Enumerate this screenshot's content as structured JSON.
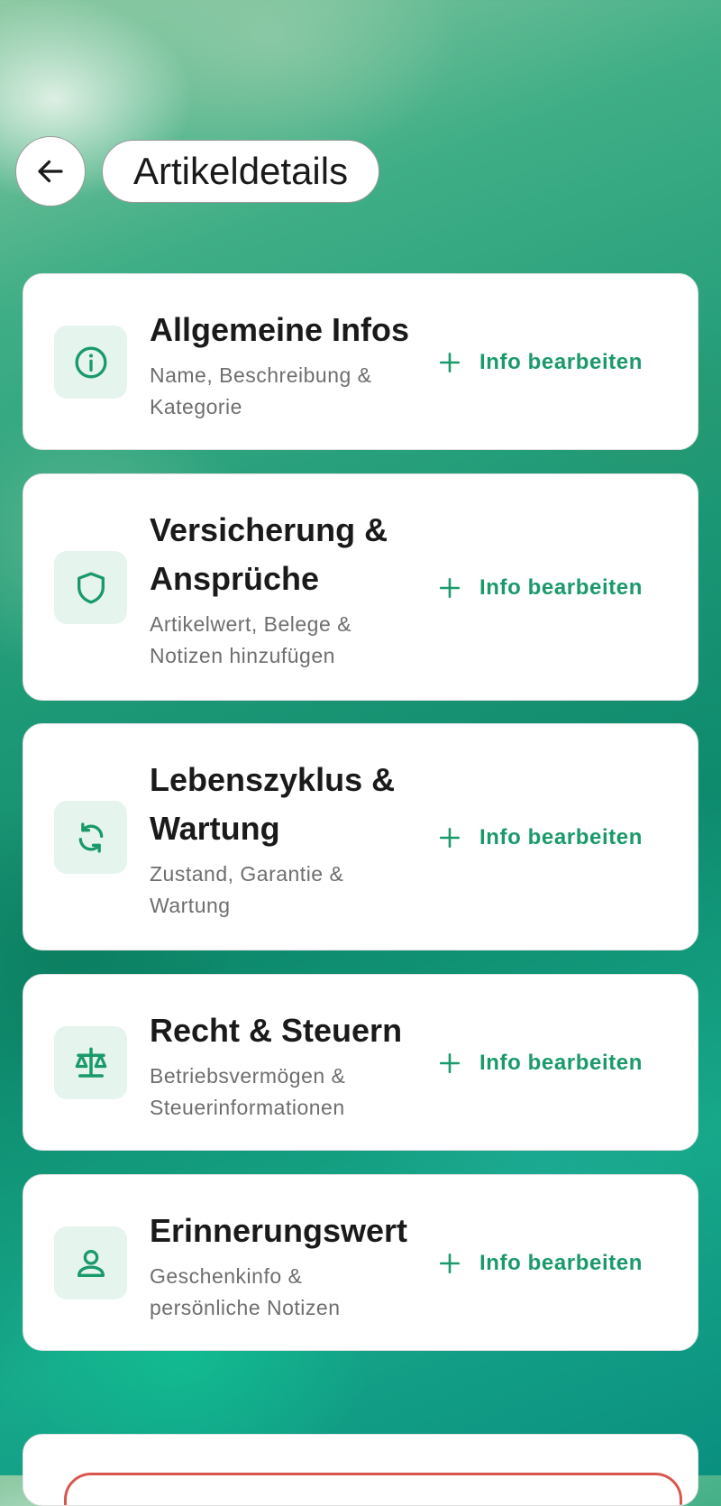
{
  "header": {
    "title": "Artikeldetails"
  },
  "sections": [
    {
      "title_lines": [
        "Allgemeine Infos"
      ],
      "subtitle_lines": [
        "Name, Beschreibung &",
        "Kategorie"
      ],
      "icon": "info-icon",
      "action_label": "Info bearbeiten"
    },
    {
      "title_lines": [
        "Versicherung &",
        "Ansprüche"
      ],
      "subtitle_lines": [
        "Artikelwert, Belege &",
        "Notizen hinzufügen"
      ],
      "icon": "shield-icon",
      "action_label": "Info bearbeiten"
    },
    {
      "title_lines": [
        "Lebenszyklus &",
        "Wartung"
      ],
      "subtitle_lines": [
        "Zustand, Garantie &",
        "Wartung"
      ],
      "icon": "refresh-icon",
      "action_label": "Info bearbeiten"
    },
    {
      "title_lines": [
        "Recht & Steuern"
      ],
      "subtitle_lines": [
        "Betriebsvermögen &",
        "Steuerinformationen"
      ],
      "icon": "scale-icon",
      "action_label": "Info bearbeiten"
    },
    {
      "title_lines": [
        "Erinnerungswert"
      ],
      "subtitle_lines": [
        "Geschenkinfo &",
        "persönliche Notizen"
      ],
      "icon": "user-icon",
      "action_label": "Info bearbeiten"
    }
  ],
  "colors": {
    "accent": "#1a9a6a",
    "icon_bg": "#e6f4ee",
    "danger": "#d9564e"
  }
}
